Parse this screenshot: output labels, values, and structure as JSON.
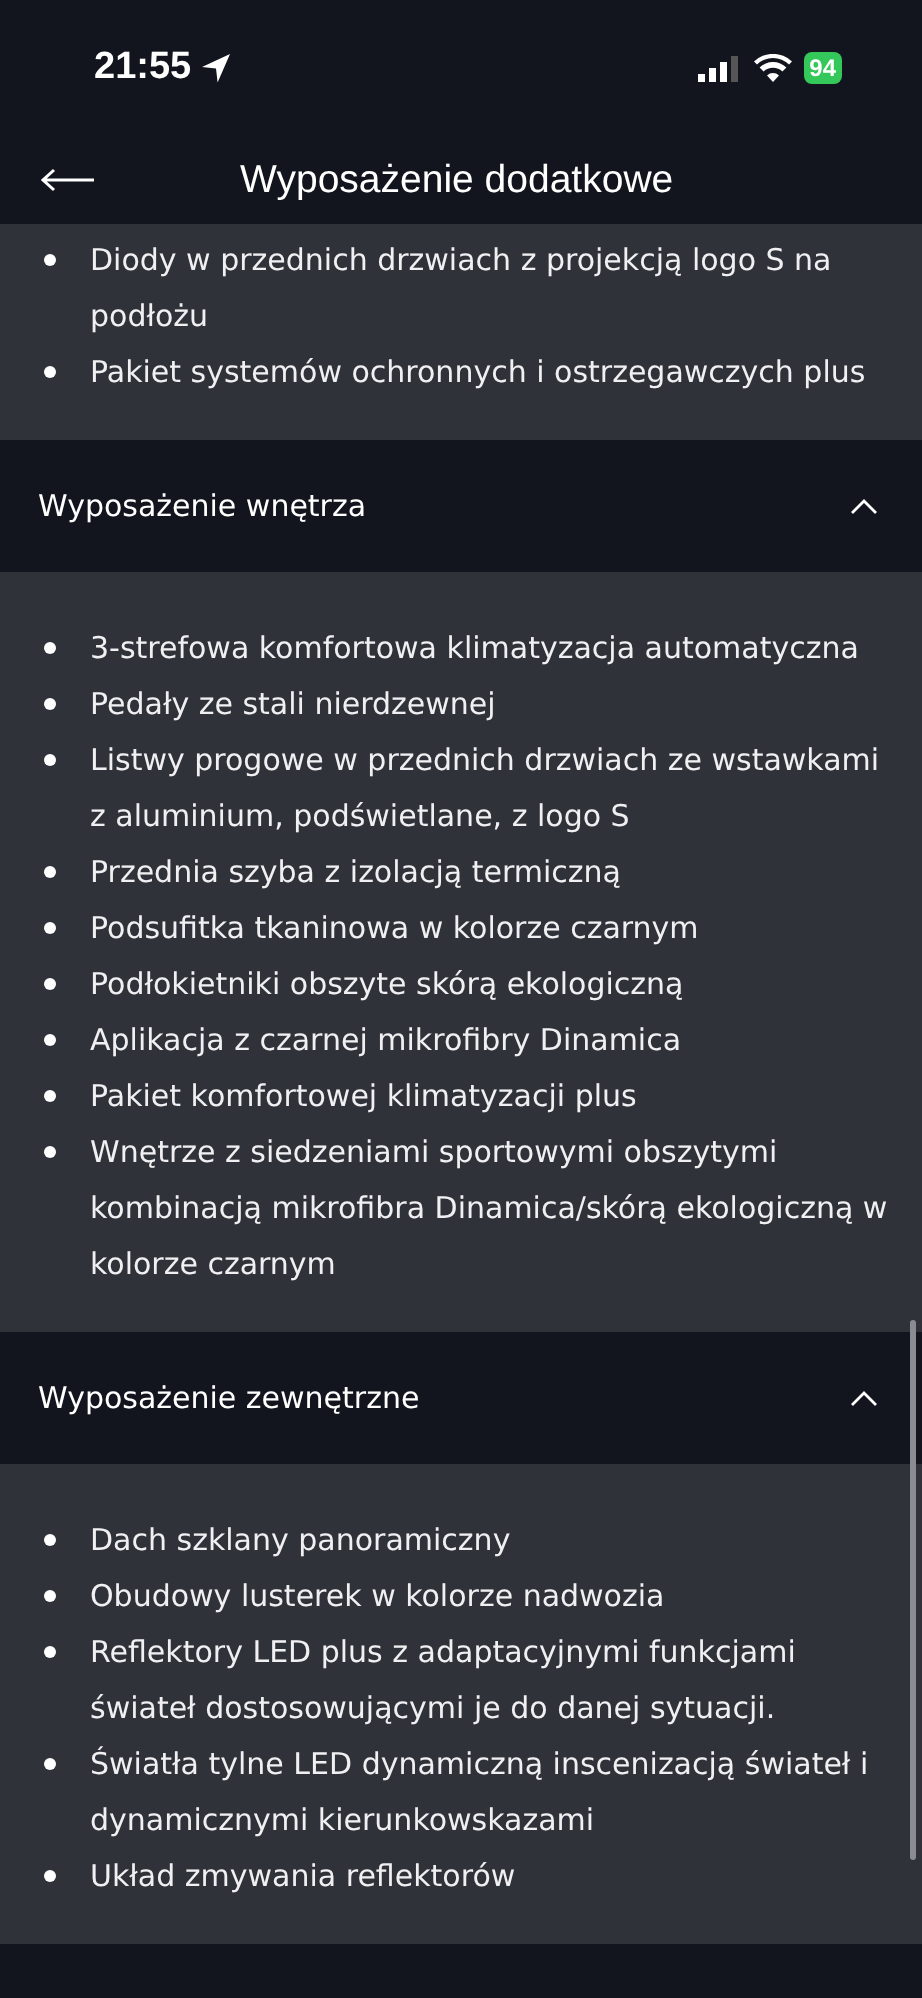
{
  "status_bar": {
    "time": "21:55",
    "battery": "94"
  },
  "header": {
    "title": "Wyposażenie dodatkowe"
  },
  "sections": [
    {
      "items": [
        "Diody w przednich drzwiach z projekcją logo S na podłożu",
        "Pakiet systemów ochronnych i ostrzegawczych plus"
      ]
    },
    {
      "title": "Wyposażenie wnętrza",
      "expanded": true,
      "items": [
        "3-strefowa komfortowa klimatyzacja automatyczna",
        "Pedały ze stali nierdzewnej",
        "Listwy progowe w przednich drzwiach ze wstawkami z aluminium, podświetlane, z logo S",
        "Przednia szyba z izolacją termiczną",
        "Podsufitka tkaninowa w kolorze czarnym",
        "Podłokietniki obszyte skórą ekologiczną",
        "Aplikacja z czarnej mikrofibry Dinamica",
        "Pakiet komfortowej klimatyzacji plus",
        "Wnętrze z siedzeniami sportowymi obszytymi kombinacją mikrofibra Dinamica/skórą ekologiczną w kolorze czarnym"
      ]
    },
    {
      "title": "Wyposażenie zewnętrzne",
      "expanded": true,
      "items": [
        "Dach szklany panoramiczny",
        "Obudowy lusterek w kolorze nadwozia",
        "Reflektory LED plus z adaptacyjnymi funkcjami świateł dostosowującymi je do danej sytuacji.",
        "Światła tylne LED dynamiczną inscenizacją świateł i dynamicznymi kierunkowskazami",
        "Układ zmywania reflektorów"
      ]
    }
  ]
}
